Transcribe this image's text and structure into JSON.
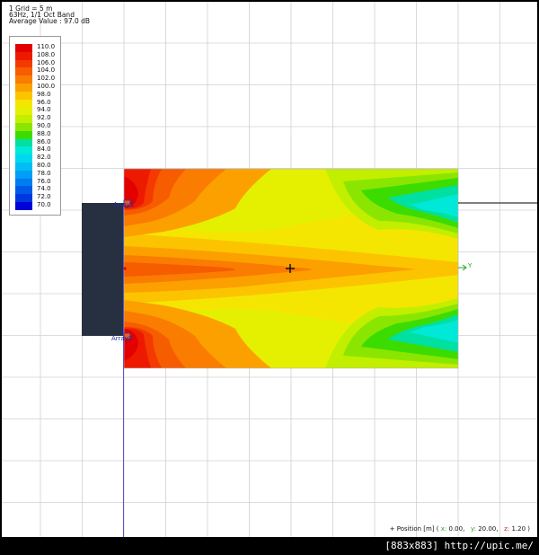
{
  "header": {
    "grid_text": "1 Grid = 5 m",
    "band_text": "63Hz, 1/1 Oct Band",
    "avg_text": "Average Value : 97.0 dB"
  },
  "legend": {
    "items": [
      {
        "label": "110.0",
        "color": "#e20000"
      },
      {
        "label": "108.0",
        "color": "#ee1a00"
      },
      {
        "label": "106.0",
        "color": "#f43a00"
      },
      {
        "label": "104.0",
        "color": "#f65c00"
      },
      {
        "label": "102.0",
        "color": "#fa7c00"
      },
      {
        "label": "100.0",
        "color": "#fca000"
      },
      {
        "label": "98.0",
        "color": "#fcc400"
      },
      {
        "label": "96.0",
        "color": "#f4e600"
      },
      {
        "label": "94.0",
        "color": "#e4f000"
      },
      {
        "label": "92.0",
        "color": "#c2ee00"
      },
      {
        "label": "90.0",
        "color": "#8ae600"
      },
      {
        "label": "88.0",
        "color": "#3cdc00"
      },
      {
        "label": "86.0",
        "color": "#00e0a0"
      },
      {
        "label": "84.0",
        "color": "#00e8d8"
      },
      {
        "label": "82.0",
        "color": "#00d8f0"
      },
      {
        "label": "80.0",
        "color": "#00bef4"
      },
      {
        "label": "78.0",
        "color": "#009ef4"
      },
      {
        "label": "76.0",
        "color": "#007cf0"
      },
      {
        "label": "74.0",
        "color": "#005ae8"
      },
      {
        "label": "72.0",
        "color": "#0038e0"
      },
      {
        "label": "70.0",
        "color": "#0000d8"
      }
    ]
  },
  "markers": {
    "top_label": "Array1",
    "bottom_label": "Array2",
    "axis_y": "Y"
  },
  "status": {
    "prefix": "+ Position [m] (",
    "x_key": "x:",
    "x_val": "0.00,",
    "y_key": "y:",
    "y_val": "20.00,",
    "z_key": "z:",
    "z_val": "1.20 )"
  },
  "footer": {
    "text": "[883x883] http://upic.me/"
  },
  "icons": {
    "cursor": "crosshair-icon",
    "speaker": "speaker-block-icon"
  }
}
